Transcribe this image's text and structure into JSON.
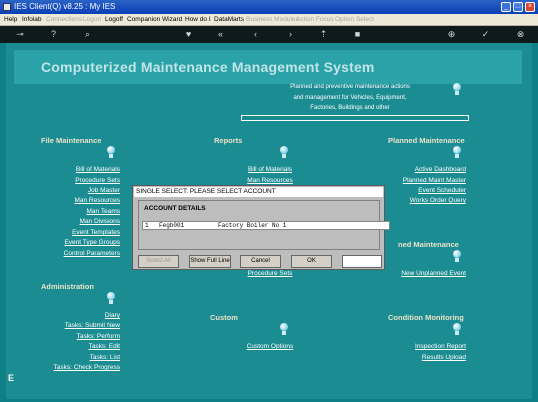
{
  "window": {
    "title": "IES Client(Q) v8.25 : My IES"
  },
  "menu": [
    {
      "label": "Help",
      "enabled": true
    },
    {
      "label": "Infolab",
      "enabled": true
    },
    {
      "label": "Connections",
      "enabled": false
    },
    {
      "label": "Logon",
      "enabled": false
    },
    {
      "label": "Logoff",
      "enabled": true
    },
    {
      "label": "Companion",
      "enabled": true
    },
    {
      "label": "Wizard",
      "enabled": true
    },
    {
      "label": "How do I",
      "enabled": true
    },
    {
      "label": "DataMarts",
      "enabled": true
    },
    {
      "label": "Business Modules",
      "enabled": false
    },
    {
      "label": "Action Focus",
      "enabled": false
    },
    {
      "label": "Option Select",
      "enabled": false
    }
  ],
  "app_title": "Computerized Maintenance Management System",
  "intro": [
    "Planned and preventive maintenance actions",
    "and management for Vehicles, Equipment,",
    "Factories, Buildings and other"
  ],
  "file_maintenance": {
    "title": "File Maintenance",
    "links": [
      "Bill of Materials",
      "Procedure Sets",
      "Job Master",
      "Man Resources",
      "Man Teams",
      "Man Divisions",
      "Event Templates",
      "Event Type Groups",
      "Control Parameters"
    ]
  },
  "reports": {
    "title": "Reports",
    "links": [
      "Bill of Materials",
      "Man Resources",
      "Procedure Sets"
    ]
  },
  "planned": {
    "title": "Planned Maintenance",
    "links": [
      "Active Dashboard",
      "Planned Maint Master",
      "Event Scheduler",
      "Works Order Query"
    ]
  },
  "unplanned": {
    "title_fragment": "ned Maintenance",
    "links": [
      "New Unplanned Event"
    ]
  },
  "administration": {
    "title": "Administration",
    "links": [
      "Diary",
      "Tasks: Submit New",
      "Tasks: Perform",
      "Tasks: Edit",
      "Tasks: List",
      "Tasks: Check Progress"
    ]
  },
  "custom": {
    "title": "Custom",
    "links": [
      "Custom Options"
    ]
  },
  "condition": {
    "title": "Condition Monitoring",
    "links": [
      "Inspection Report",
      "Results Upload"
    ]
  },
  "dialog": {
    "title": "SINGLE SELECT: PLEASE SELECT ACCOUNT",
    "section": "ACCOUNT DETAILS",
    "row": {
      "num": "1",
      "code": "Fegb001",
      "name": "Factory Boiler No 1"
    },
    "buttons": {
      "select_all": "Select All",
      "show_full_line": "Show Full Line",
      "cancel": "Cancel",
      "ok": "OK"
    },
    "input_value": ""
  },
  "left_mark": "E",
  "colors": {
    "background": "#1c8c93",
    "title_bar": "#0a3fb5",
    "section_title": "#e9e3c9"
  }
}
